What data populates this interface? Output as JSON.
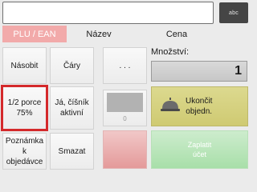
{
  "search": {
    "value": "",
    "keyboard_label": "abc"
  },
  "tabs": [
    {
      "label": "PLU / EAN",
      "active": true
    },
    {
      "label": "Název",
      "active": false
    },
    {
      "label": "Cena",
      "active": false
    }
  ],
  "buttons": {
    "nasobit": "Násobit",
    "cary": "Čáry",
    "more": ". . .",
    "half_portion": "1/2 porce\n75%",
    "waiter_active": "Já, číšník\naktivní",
    "note": "Poznámka k\nobjedávce",
    "delete": "Smazat",
    "finish_order": "Ukončit\nobjedn.",
    "pay_bill": "Zaplatit\núčet"
  },
  "quantity": {
    "label": "Množství:",
    "value": "1"
  },
  "gray_tile": {
    "value": "0"
  },
  "colors": {
    "tab_active": "#f2aaaa",
    "highlight_border": "#d4292b",
    "finish_order": "#d4d07e",
    "pay_bill": "#b6e4b6",
    "red_tile": "#eab0b0"
  },
  "icons": {
    "finish_order_icon": "service-bell-icon"
  }
}
